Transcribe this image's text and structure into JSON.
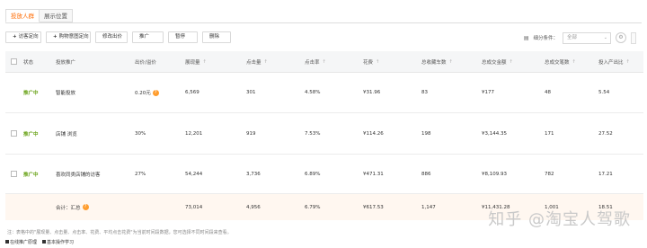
{
  "tabs": [
    {
      "label": "投放人群",
      "active": true
    },
    {
      "label": "展示位置",
      "active": false
    }
  ],
  "toolbar": {
    "add_crowd": "访客定向",
    "add_favorite": "购物意图定向",
    "edit_bid": "修改出价",
    "promote": "推广",
    "pause": "暂停",
    "delete": "删除"
  },
  "filter": {
    "label": "细分条件：",
    "select_value": "全部",
    "chevron": "chevron-down-icon",
    "gear": "gear-icon"
  },
  "table": {
    "headers": {
      "status": "状态",
      "name": "投放推广",
      "bid": "出价/溢价",
      "impressions": "展现量",
      "clicks": "点击量",
      "ctr": "点击率",
      "cost": "花费",
      "favorites": "总收藏车数",
      "amount": "总成交金额",
      "orders": "总成交笔数",
      "roi": "投入产出比"
    },
    "sort_arrow": "↑",
    "rows": [
      {
        "status": "推广中",
        "name": "智能投放",
        "bid": "0.20元",
        "impressions": "6,569",
        "clicks": "301",
        "ctr": "4.58%",
        "cost": "¥31.96",
        "favorites": "83",
        "amount": "¥177",
        "orders": "48",
        "roi": "5.54"
      },
      {
        "status": "推广中",
        "name": "店铺 浏览",
        "bid": "30%",
        "impressions": "12,201",
        "clicks": "919",
        "ctr": "7.53%",
        "cost": "¥114.26",
        "favorites": "198",
        "amount": "¥3,144.35",
        "orders": "171",
        "roi": "27.52"
      },
      {
        "status": "推广中",
        "name": "喜欢同类店铺的访客",
        "bid": "27%",
        "impressions": "54,244",
        "clicks": "3,736",
        "ctr": "6.89%",
        "cost": "¥471.31",
        "favorites": "886",
        "amount": "¥8,109.93",
        "orders": "782",
        "roi": "17.21"
      }
    ],
    "total": {
      "label": "合计：汇总",
      "impressions": "73,014",
      "clicks": "4,956",
      "ctr": "6.79%",
      "cost": "¥617.53",
      "favorites": "1,147",
      "amount": "¥11,431.28",
      "orders": "1,001",
      "roi": "18.51"
    }
  },
  "note": "注：表格中的\"展现量、点击量、点击率、花费、平均点击花费\"为当前时间段数据，您可选择不同时间段来查看。",
  "footer": [
    "在线推广原理",
    "基本操作学习"
  ],
  "watermark": "知乎 @淘宝人驾歌"
}
